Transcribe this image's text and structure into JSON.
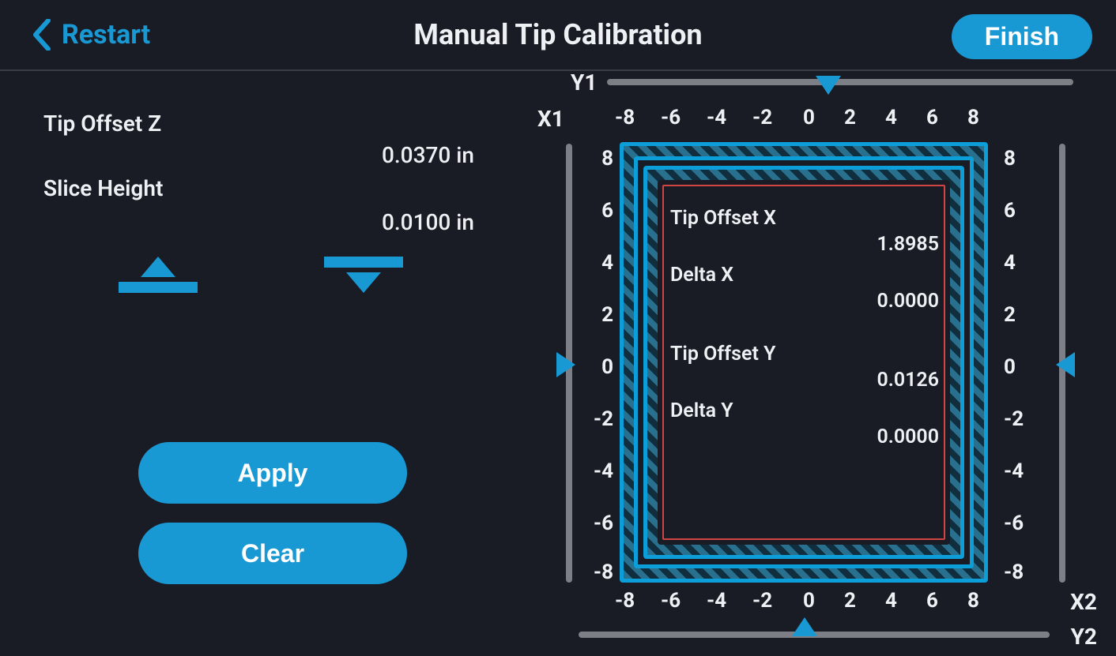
{
  "header": {
    "back_label": "Restart",
    "title": "Manual Tip Calibration",
    "finish_label": "Finish"
  },
  "left": {
    "tip_offset_z_label": "Tip Offset Z",
    "tip_offset_z_value": "0.0370 in",
    "slice_height_label": "Slice Height",
    "slice_height_value": "0.0100 in",
    "apply_label": "Apply",
    "clear_label": "Clear"
  },
  "axes": {
    "Y1": "Y1",
    "X1": "X1",
    "X2": "X2",
    "Y2": "Y2",
    "ticks": [
      "-8",
      "-6",
      "-4",
      "-2",
      "0",
      "2",
      "4",
      "6",
      "8"
    ],
    "ticks_left": [
      "8",
      "6",
      "4",
      "2",
      "0",
      "-2",
      "-4",
      "-6",
      "-8"
    ],
    "ticks_right": [
      "8",
      "6",
      "4",
      "2",
      "0",
      "-2",
      "-4",
      "-6",
      "-8"
    ]
  },
  "center": {
    "tip_offset_x_label": "Tip Offset X",
    "tip_offset_x_value": "1.8985",
    "delta_x_label": "Delta X",
    "delta_x_value": "0.0000",
    "tip_offset_y_label": "Tip Offset Y",
    "tip_offset_y_value": "0.0126",
    "delta_y_label": "Delta Y",
    "delta_y_value": "0.0000"
  },
  "sliders": {
    "y1_pos": 0,
    "y2_pos": 0,
    "x1_pos": 0,
    "x2_pos": 0
  }
}
